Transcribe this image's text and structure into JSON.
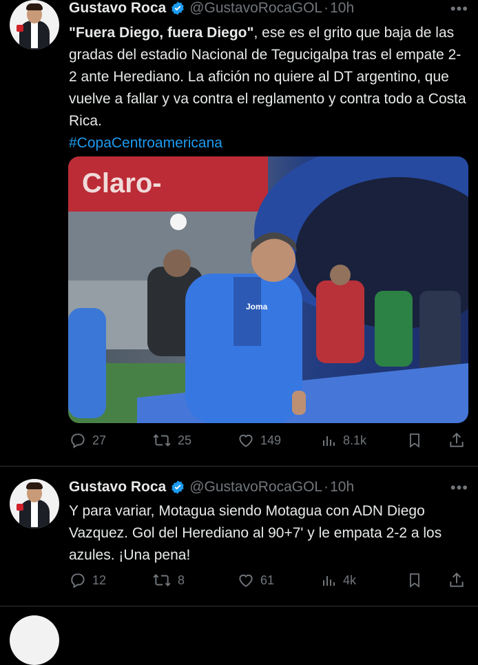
{
  "tweets": [
    {
      "author": "Gustavo Roca",
      "handle": "@GustavoRocaGOL",
      "separator": "·",
      "time": "10h",
      "text_bold": "\"Fuera Diego, fuera Diego\"",
      "text_rest": ", ese es el grito que baja de las gradas del estadio Nacional de Tegucigalpa tras el empate 2-2 ante Herediano. La afición no quiere al DT argentino, que vuelve a fallar y va contra el reglamento y contra todo a Costa Rica.",
      "hashtag": "#CopaCentroamericana",
      "media": {
        "banner_text": "Claro-",
        "jacket_logo": "Joma"
      },
      "stats": {
        "replies": "27",
        "reposts": "25",
        "likes": "149",
        "views": "8.1k"
      }
    },
    {
      "author": "Gustavo Roca",
      "handle": "@GustavoRocaGOL",
      "separator": "·",
      "time": "10h",
      "text": "Y para variar, Motagua siendo Motagua con ADN Diego Vazquez. Gol del Herediano al 90+7' y le empata 2-2 a los azules. ¡Una pena!",
      "stats": {
        "replies": "12",
        "reposts": "8",
        "likes": "61",
        "views": "4k"
      }
    }
  ],
  "colors": {
    "accent": "#1d9bf0",
    "muted": "#71767b",
    "text": "#e7e9ea",
    "background": "#000000"
  }
}
